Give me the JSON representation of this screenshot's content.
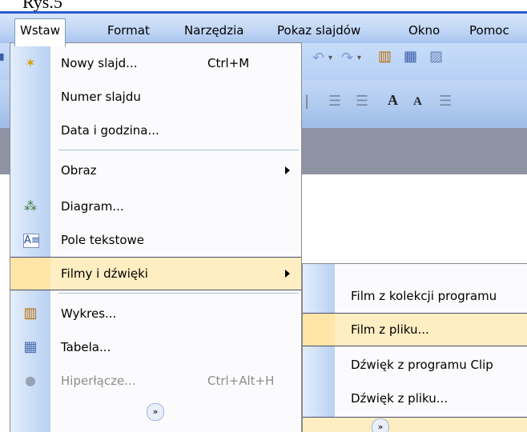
{
  "caption": "Rys.5",
  "menubar": {
    "items": [
      {
        "label": "Wstaw",
        "active": true
      },
      {
        "label": "Format"
      },
      {
        "label": "Narzędzia"
      },
      {
        "label": "Pokaz slajdów"
      },
      {
        "label": "Okno"
      },
      {
        "label": "Pomoc"
      }
    ]
  },
  "insert_menu": {
    "items": [
      {
        "label": "Nowy slajd...",
        "shortcut": "Ctrl+M",
        "icon": "new-slide-icon"
      },
      {
        "label": "Numer slajdu"
      },
      {
        "label": "Data i godzina..."
      },
      {
        "label": "Obraz",
        "submenu": true
      },
      {
        "label": "Diagram...",
        "icon": "diagram-icon"
      },
      {
        "label": "Pole tekstowe",
        "icon": "textbox-icon"
      },
      {
        "label": "Filmy i dźwięki",
        "submenu": true,
        "highlighted": true
      },
      {
        "label": "Wykres...",
        "icon": "chart-icon"
      },
      {
        "label": "Tabela...",
        "icon": "table-icon"
      },
      {
        "label": "Hiperłącze...",
        "shortcut": "Ctrl+Alt+H",
        "icon": "hyperlink-icon",
        "disabled": true
      }
    ]
  },
  "media_submenu": {
    "items": [
      {
        "label": "Film z kolekcji programu"
      },
      {
        "label": "Film z pliku...",
        "highlighted": true
      },
      {
        "label": "Dźwięk z programu Clip"
      },
      {
        "label": "Dźwięk z pliku..."
      }
    ]
  },
  "colors": {
    "menubar": "#c2d7f5",
    "highlight": "#ffeec2",
    "active_border": "#2a5bd6"
  }
}
